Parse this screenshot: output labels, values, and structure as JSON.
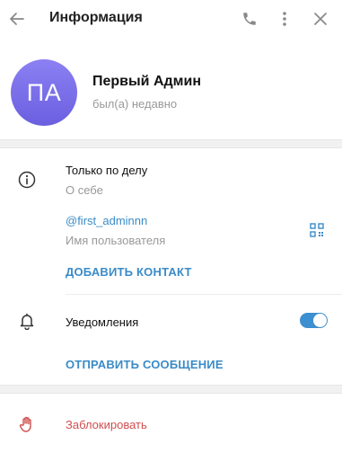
{
  "header": {
    "title": "Информация",
    "back_icon": "arrow-left-icon",
    "call_icon": "phone-icon",
    "menu_icon": "more-vertical-icon",
    "close_icon": "close-icon"
  },
  "profile": {
    "initials": "ПА",
    "name": "Первый Админ",
    "status": "был(а) недавно",
    "avatar_gradient": [
      "#8c80f3",
      "#6b5fe0"
    ]
  },
  "info": {
    "bio": {
      "value": "Только по делу",
      "label": "О себе",
      "icon": "info-icon"
    },
    "username": {
      "value": "@first_adminnn",
      "label": "Имя пользователя",
      "qr_icon": "qr-code-icon"
    },
    "add_contact_label": "ДОБАВИТЬ КОНТАКТ"
  },
  "notifications": {
    "label": "Уведомления",
    "icon": "bell-icon",
    "enabled": true,
    "send_message_label": "ОТПРАВИТЬ СООБЩЕНИЕ"
  },
  "block": {
    "label": "Заблокировать",
    "icon": "hand-stop-icon"
  },
  "colors": {
    "accent": "#3a8bc8",
    "danger": "#d14e4e",
    "secondary_text": "#999999"
  }
}
